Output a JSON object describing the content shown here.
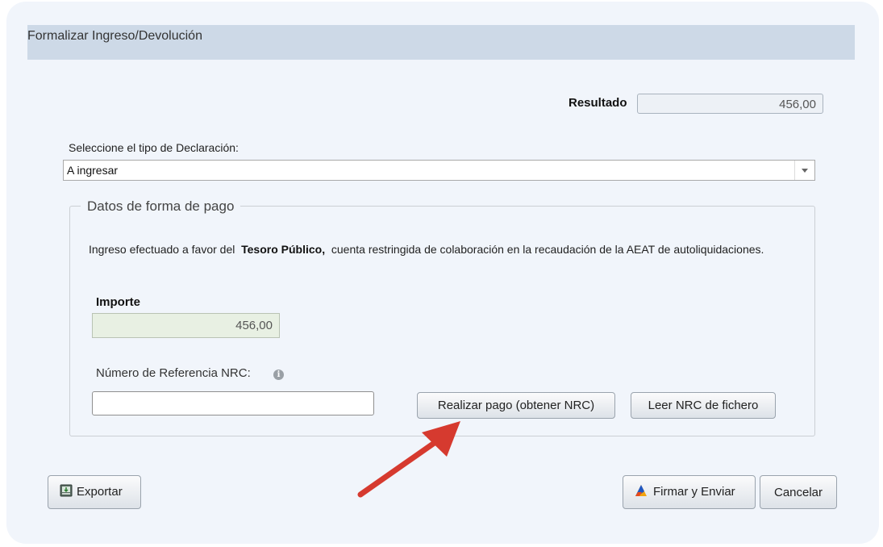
{
  "dialog": {
    "title": "Formalizar Ingreso/Devolución"
  },
  "resultado": {
    "label": "Resultado",
    "value": "456,00"
  },
  "declaracion": {
    "label": "Seleccione el tipo de Declaración:",
    "selected": "A ingresar"
  },
  "pago": {
    "legend": "Datos de forma de pago",
    "info_prefix": "Ingreso efectuado a favor del",
    "info_bold": "Tesoro Público,",
    "info_suffix": "cuenta restringida de colaboración en la recaudación de la AEAT de autoliquidaciones.",
    "importe_label": "Importe",
    "importe_value": "456,00",
    "nrc_label": "Número de Referencia NRC:",
    "nrc_value": "",
    "pay_button": "Realizar pago (obtener NRC)",
    "read_button": "Leer NRC de fichero"
  },
  "footer": {
    "export_button": "Exportar",
    "sign_button": "Firmar y Enviar",
    "cancel_button": "Cancelar"
  },
  "icons": {
    "info": "info-icon",
    "export": "export-icon",
    "sign": "sign-icon",
    "dropdown": "chevron-down-icon",
    "annotation": "red-arrow-annotation"
  },
  "colors": {
    "titlebar": "#cdd9e7",
    "dialog_bg": "#f1f5fb",
    "importe_bg": "#e8f0e3",
    "arrow": "#d63a2f"
  }
}
